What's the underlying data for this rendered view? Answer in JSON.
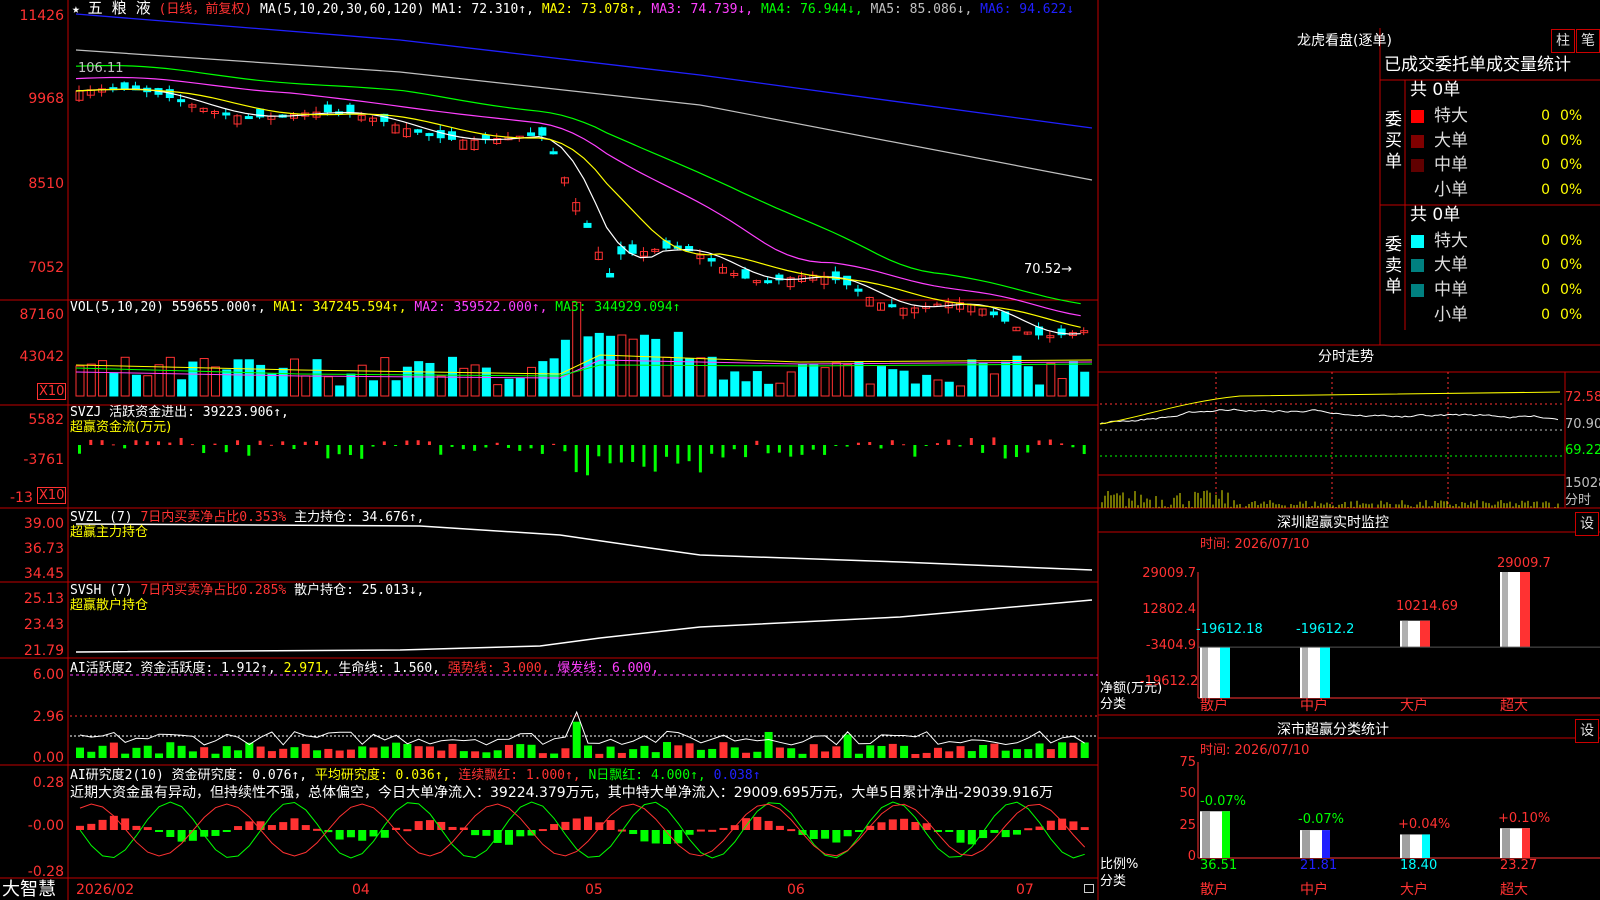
{
  "main": {
    "stock_name": "五 粮 液",
    "period": "(日线，前复权)",
    "ma_set": "MA(5,10,20,30,60,120)",
    "ma": [
      {
        "label": "MA1: 72.310↑,",
        "color": "#ffffff"
      },
      {
        "label": "MA2: 73.078↑,",
        "color": "#ffff00"
      },
      {
        "label": "MA3: 74.739↓,",
        "color": "#ff40ff"
      },
      {
        "label": "MA4: 76.944↓,",
        "color": "#00ff00"
      },
      {
        "label": "MA5: 85.086↓,",
        "color": "#c0c0c0"
      },
      {
        "label": "MA6: 94.622↓",
        "color": "#2020ff"
      }
    ],
    "y_labels": [
      "11426",
      "9968",
      "8510",
      "7052"
    ],
    "annot_high": "106.11",
    "annot_low": "70.52→",
    "star": "★"
  },
  "vol": {
    "title": "VOL(5,10,20)",
    "value": "559655.000↑,",
    "ma1": "MA1: 347245.594↑,",
    "ma2": "MA2: 359522.000↑,",
    "ma3": "MA3: 344929.094↑",
    "y_labels": [
      "87160",
      "43042"
    ],
    "multiplier": "X10"
  },
  "svzj": {
    "title": "SVZJ  活跃资金进出: 39223.906↑,",
    "subtitle": "超赢资金流(万元)",
    "y_labels": [
      "5582",
      "-3761",
      "-13"
    ],
    "multiplier": "X10"
  },
  "svzl": {
    "title": "SVZL (7)",
    "t2": "7日内买卖净占比0.353%",
    "t3": "主力持仓: 34.676↑,",
    "subtitle": "超赢主力持仓",
    "y_labels": [
      "39.00",
      "36.73",
      "34.45"
    ]
  },
  "svsh": {
    "title": "SVSH (7)",
    "t2": "7日内买卖净占比0.285%",
    "t3": "散户持仓: 25.013↓,",
    "subtitle": "超赢散户持仓",
    "y_labels": [
      "25.13",
      "23.43",
      "21.79"
    ]
  },
  "ai1": {
    "title": "AI活跃度2",
    "t1": "资金活跃度: 1.912↑,",
    "t2": "2.971,",
    "t3": "生命线: 1.560,",
    "t4": "强势线: 3.000,",
    "t5": "爆发线: 6.000,",
    "y_labels": [
      "6.00",
      "2.96",
      "0.00"
    ]
  },
  "ai2": {
    "title": "AI研究度2(10)",
    "t1": "资金研究度: 0.076↑,",
    "t2": "平均研究度: 0.036↑,",
    "t3": "连续飘红: 1.000↑,",
    "t4": "N日飘红: 4.000↑,",
    "t5": "0.038↑",
    "comment": "近期大资金虽有异动，但持续性不强，总体偏空，今日大单净流入：39224.379万元，其中特大单净流入：29009.695万元，大单5日累计净出-29039.916万",
    "y_labels": [
      "0.28",
      "-0.00",
      "-0.28"
    ]
  },
  "xaxis": {
    "labels": [
      "2026/02",
      "04",
      "05",
      "06",
      "07"
    ],
    "brand": "大智慧"
  },
  "right": {
    "title": "龙虎看盘(逐单)",
    "btn1": "柱",
    "btn2": "笔",
    "stat_title": "已成交委托单成交量统计",
    "buy": {
      "side_label": "委买单",
      "total": "共 0单",
      "rows": [
        {
          "label": "特大",
          "value": "0",
          "pct": "0%",
          "color": "#ff0000"
        },
        {
          "label": "大单",
          "value": "0",
          "pct": "0%",
          "color": "#800000"
        },
        {
          "label": "中单",
          "value": "0",
          "pct": "0%",
          "color": "#600000"
        },
        {
          "label": "小单",
          "value": "0",
          "pct": "0%",
          "color": "#000000"
        }
      ]
    },
    "sell": {
      "side_label": "委卖单",
      "total": "共 0单",
      "rows": [
        {
          "label": "特大",
          "value": "0",
          "pct": "0%",
          "color": "#00ffff"
        },
        {
          "label": "大单",
          "value": "0",
          "pct": "0%",
          "color": "#008080"
        },
        {
          "label": "中单",
          "value": "0",
          "pct": "0%",
          "color": "#008080"
        },
        {
          "label": "小单",
          "value": "0",
          "pct": "0%",
          "color": "#000000"
        }
      ]
    },
    "intraday": {
      "title": "分时走势",
      "y_labels": [
        "72.58",
        "70.90",
        "69.22"
      ],
      "vol_label": "15028",
      "vol_unit": "分时"
    },
    "sz_monitor": {
      "title": "深圳超赢实时监控",
      "btn": "设",
      "time": "时间: 2026/07/10",
      "y_labels": [
        "29009.7",
        "12802.4",
        "-3404.9",
        "-19612.2"
      ],
      "y_title": "净额(万元)",
      "x_title": "分类",
      "bars": [
        {
          "label": "散户",
          "value": -19612.18,
          "text": "-19612.18",
          "color": "#00ffff"
        },
        {
          "label": "中户",
          "value": -19612.2,
          "text": "-19612.2",
          "color": "#00ffff"
        },
        {
          "label": "大户",
          "value": 10214.69,
          "text": "10214.69",
          "color": "#ff3232"
        },
        {
          "label": "超大",
          "value": 29009.7,
          "text": "29009.7",
          "color": "#ff3232"
        }
      ]
    },
    "sz_class": {
      "title": "深市超赢分类统计",
      "btn": "设",
      "time": "时间: 2026/07/10",
      "y_labels": [
        "75",
        "50",
        "25",
        "0"
      ],
      "y_title": "比例%",
      "x_title": "分类",
      "bars": [
        {
          "label": "散户",
          "value": 36.51,
          "text": "36.51",
          "delta": "-0.07%",
          "color": "#00ff00",
          "tcolor": "#00ff00"
        },
        {
          "label": "中户",
          "value": 21.81,
          "text": "21.81",
          "delta": "-0.07%",
          "color": "#2020ff",
          "tcolor": "#00ff00"
        },
        {
          "label": "大户",
          "value": 18.4,
          "text": "18.40",
          "delta": "+0.04%",
          "color": "#00ffff",
          "tcolor": "#ff3232"
        },
        {
          "label": "超大",
          "value": 23.27,
          "text": "23.27",
          "delta": "+0.10%",
          "color": "#ff3232",
          "tcolor": "#ff3232"
        }
      ]
    }
  },
  "colors": {
    "up": "#ff3232",
    "down": "#00ffff",
    "border": "#c00000"
  }
}
